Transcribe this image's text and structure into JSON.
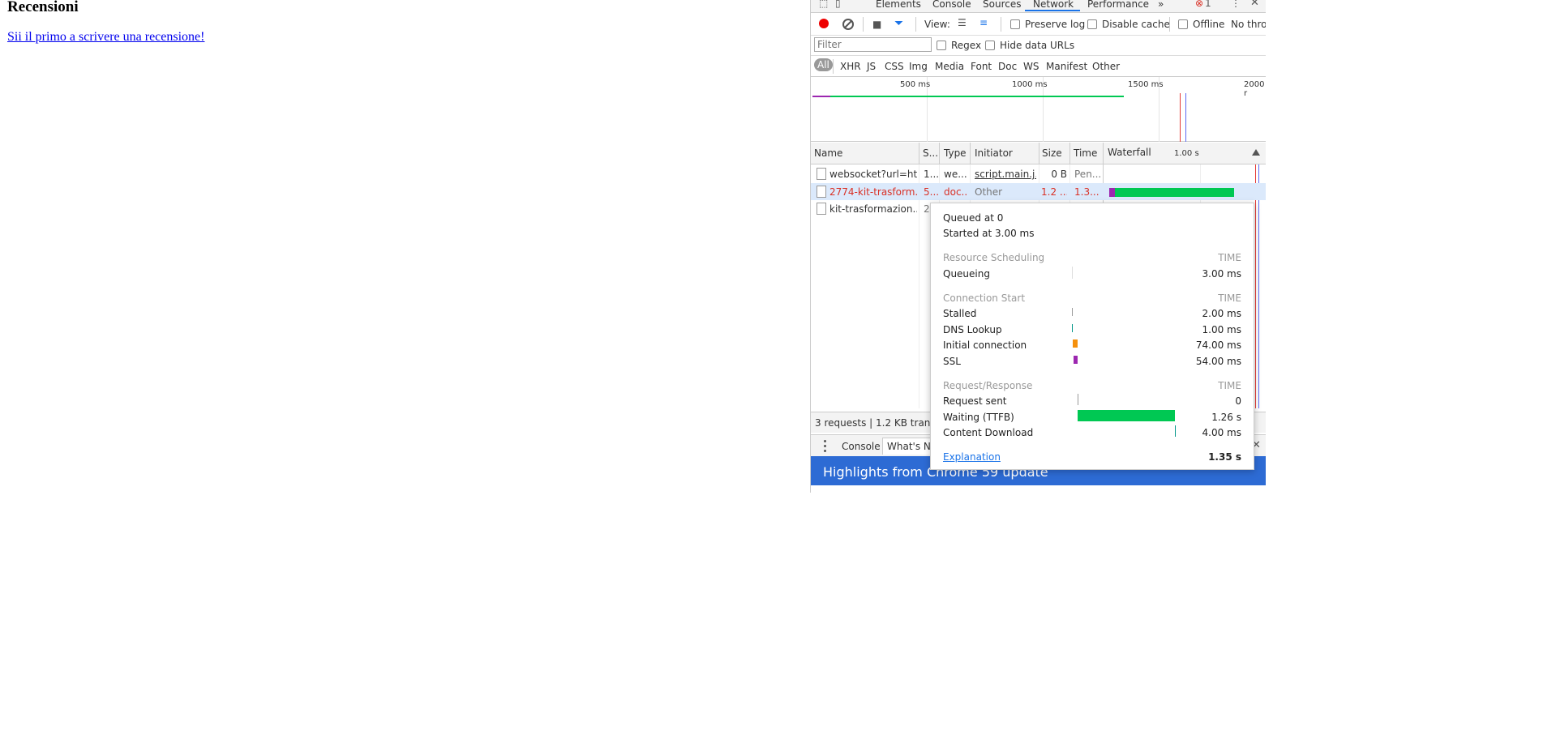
{
  "page": {
    "title": "Recensioni",
    "link": "Sii il primo a scrivere una recensione!"
  },
  "devtools": {
    "tabs": [
      "Elements",
      "Console",
      "Sources",
      "Network",
      "Performance"
    ],
    "more_tabs": "»",
    "error_count": "1",
    "error_icon": "error-x-icon",
    "kebab_icon": "kebab-icon",
    "close_glyph": "✕",
    "toolbar": {
      "view_label": "View:",
      "preserve_log": "Preserve log",
      "disable_cache": "Disable cache",
      "offline": "Offline",
      "throttle": "No thro"
    },
    "filter": {
      "placeholder": "Filter",
      "regex": "Regex",
      "hide_data_urls": "Hide data URLs"
    },
    "types": [
      "All",
      "XHR",
      "JS",
      "CSS",
      "Img",
      "Media",
      "Font",
      "Doc",
      "WS",
      "Manifest",
      "Other"
    ],
    "overview": {
      "ticks": [
        "500 ms",
        "1000 ms",
        "1500 ms",
        "2000 r"
      ]
    },
    "columns": {
      "name": "Name",
      "status": "S...",
      "type": "Type",
      "initiator": "Initiator",
      "size": "Size",
      "time": "Time",
      "waterfall": "Waterfall",
      "waterfall_tick": "1.00 s"
    },
    "requests": [
      {
        "name": "websocket?url=ht...",
        "status": "1...",
        "type": "we...",
        "initiator": "script.main.j...",
        "size": "0 B",
        "time": "Pen..."
      },
      {
        "name": "2774-kit-trasform...",
        "status": "5...",
        "type": "doc...",
        "initiator": "Other",
        "size": "1.2 ...",
        "time": "1.3..."
      },
      {
        "name": "kit-trasformazion...",
        "status": "2",
        "type": "",
        "initiator": "",
        "size": "",
        "time": ""
      }
    ],
    "summary": "3 requests | 1.2 KB transfe",
    "drawer": {
      "tabs": [
        "Console",
        "What's Ne"
      ],
      "banner": "Highlights from Chrome 59 update"
    },
    "colors": {
      "accent": "#1a73e8",
      "record": "#e00000",
      "error_row": "#d93025",
      "ttfb": "#00c853",
      "initial_connection": "#f5900c",
      "ssl": "#9c27b0",
      "banner": "#2d6bd4"
    }
  },
  "timing": {
    "queued": "Queued at 0",
    "started": "Started at 3.00 ms",
    "sections": [
      {
        "title": "Resource Scheduling",
        "time_header": "TIME",
        "rows": [
          {
            "label": "Queueing",
            "value": "3.00 ms"
          }
        ]
      },
      {
        "title": "Connection Start",
        "time_header": "TIME",
        "rows": [
          {
            "label": "Stalled",
            "value": "2.00 ms"
          },
          {
            "label": "DNS Lookup",
            "value": "1.00 ms"
          },
          {
            "label": "Initial connection",
            "value": "74.00 ms"
          },
          {
            "label": "SSL",
            "value": "54.00 ms"
          }
        ]
      },
      {
        "title": "Request/Response",
        "time_header": "TIME",
        "rows": [
          {
            "label": "Request sent",
            "value": "0"
          },
          {
            "label": "Waiting (TTFB)",
            "value": "1.26 s"
          },
          {
            "label": "Content Download",
            "value": "4.00 ms"
          }
        ]
      }
    ],
    "explanation": "Explanation",
    "total": "1.35 s"
  }
}
